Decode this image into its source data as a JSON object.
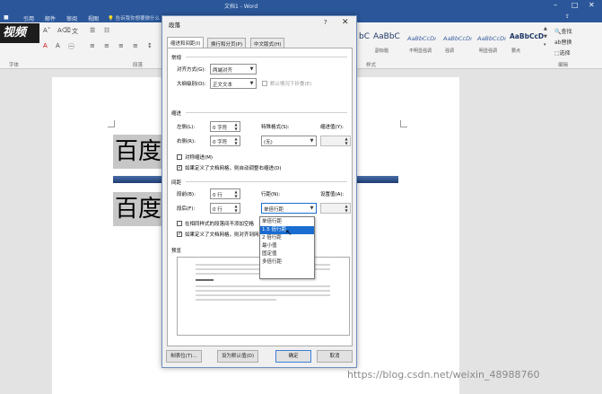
{
  "window": {
    "title": "文档1 - Word"
  },
  "ribbon": {
    "tabs": [
      "引用",
      "邮件",
      "审阅",
      "视图"
    ],
    "tell_me": "告诉我你想要做什么",
    "groups": {
      "font": "字体",
      "paragraph": "段落",
      "styles": "样式",
      "editing": "编辑"
    },
    "styles": [
      {
        "sample": "bC",
        "name": ""
      },
      {
        "sample": "AaBbC",
        "name": "副标题"
      },
      {
        "sample": "AaBbCcDı",
        "name": "不明显强调"
      },
      {
        "sample": "AaBbCcDı",
        "name": "强调"
      },
      {
        "sample": "AaBbCcDı",
        "name": "明显强调"
      },
      {
        "sample": "AaBbCcD",
        "name": "要点"
      }
    ],
    "editing": {
      "find": "查找",
      "replace": "替换",
      "select": "选择"
    }
  },
  "overlay_logo": "视频",
  "document": {
    "line1": "百度",
    "line2": "百度"
  },
  "dialog": {
    "title": "段落",
    "tabs": [
      "缩进和间距(I)",
      "换行和分页(P)",
      "中文版式(H)"
    ],
    "general": {
      "heading": "常规",
      "alignment_label": "对齐方式(G):",
      "alignment_value": "两端对齐",
      "outline_label": "大纲级别(O):",
      "outline_value": "正文文本",
      "collapsed_label": "默认情况下折叠(E)"
    },
    "indent": {
      "heading": "缩进",
      "left_label": "左侧(L):",
      "left_value": "0 字符",
      "right_label": "右侧(R):",
      "right_value": "0 字符",
      "special_label": "特殊格式(S):",
      "special_value": "(无)",
      "indent_by_label": "缩进值(Y):",
      "mirror_label": "对称缩进(M)",
      "auto_adjust_label": "如果定义了文档网格，则自动调整右缩进(D)"
    },
    "spacing": {
      "heading": "间距",
      "before_label": "段前(B):",
      "before_value": "0 行",
      "after_label": "段后(F):",
      "after_value": "0 行",
      "line_label": "行距(N):",
      "line_value": "单倍行距",
      "at_label": "设置值(A):",
      "no_space_label": "在相同样式的段落间不添加空格",
      "snap_grid_label": "如果定义了文档网格，则对齐到网格",
      "line_options": [
        "单倍行距",
        "1.5 倍行距",
        "2 倍行距",
        "最小值",
        "固定值",
        "多倍行距"
      ],
      "selected_option": "1.5 倍行距"
    },
    "preview": {
      "heading": "预览"
    },
    "buttons": {
      "tabs": "制表位(T)...",
      "default": "设为默认值(D)",
      "ok": "确定",
      "cancel": "取消"
    }
  },
  "watermark": "https://blog.csdn.net/weixin_48988760",
  "colors": {
    "word_blue": "#2b579a",
    "selection": "#1a6dd0"
  }
}
